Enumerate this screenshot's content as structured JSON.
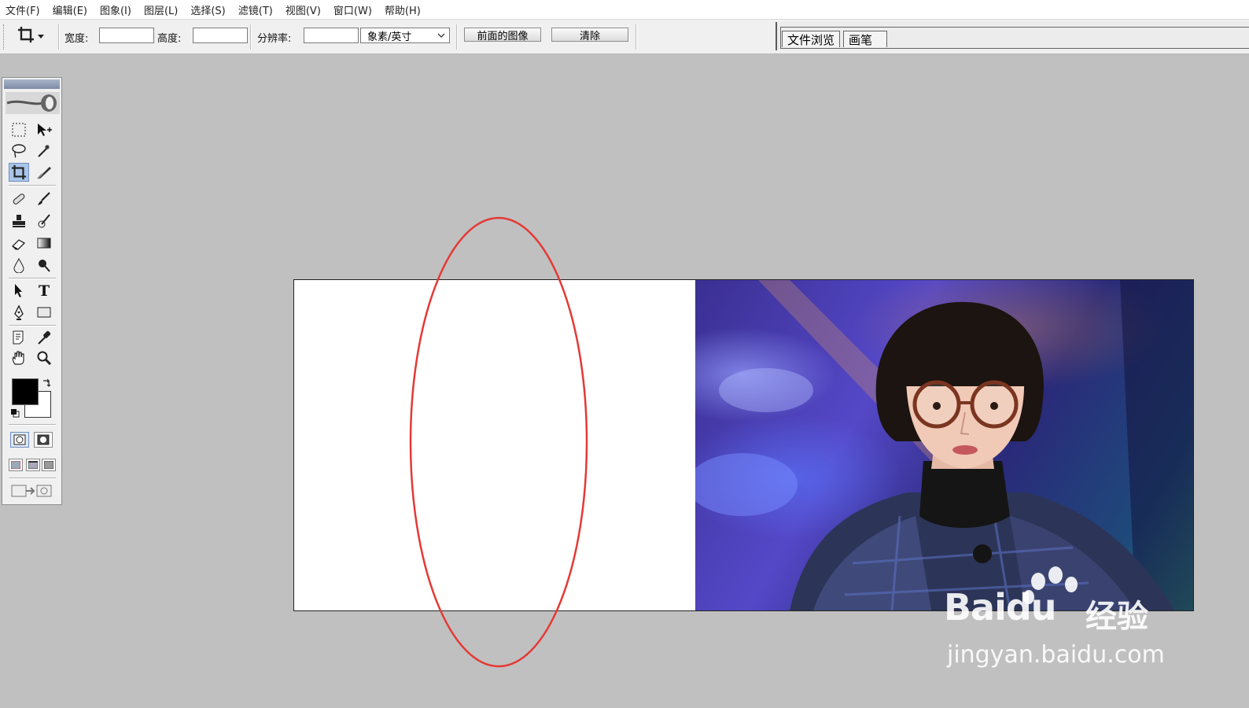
{
  "menu": [
    "文件(F)",
    "编辑(E)",
    "图象(I)",
    "图层(L)",
    "选择(S)",
    "滤镜(T)",
    "视图(V)",
    "窗口(W)",
    "帮助(H)"
  ],
  "options": {
    "width_label": "宽度:",
    "height_label": "高度:",
    "resolution_label": "分辨率:",
    "width_value": "",
    "height_value": "",
    "resolution_value": "",
    "unit_selected": "象素/英寸",
    "front_image_button": "前面的图像",
    "clear_button": "清除"
  },
  "palette_well": {
    "tabs": [
      "文件浏览",
      "画笔"
    ]
  },
  "toolbox": {
    "active_tool": "crop-tool",
    "foreground_color": "#000000",
    "background_color": "#ffffff"
  },
  "canvas": {
    "background": "#ffffff",
    "annotation_color": "#e53935"
  },
  "watermark": {
    "brand": "Baidu",
    "brand_cn": "经验",
    "url": "jingyan.baidu.com"
  }
}
